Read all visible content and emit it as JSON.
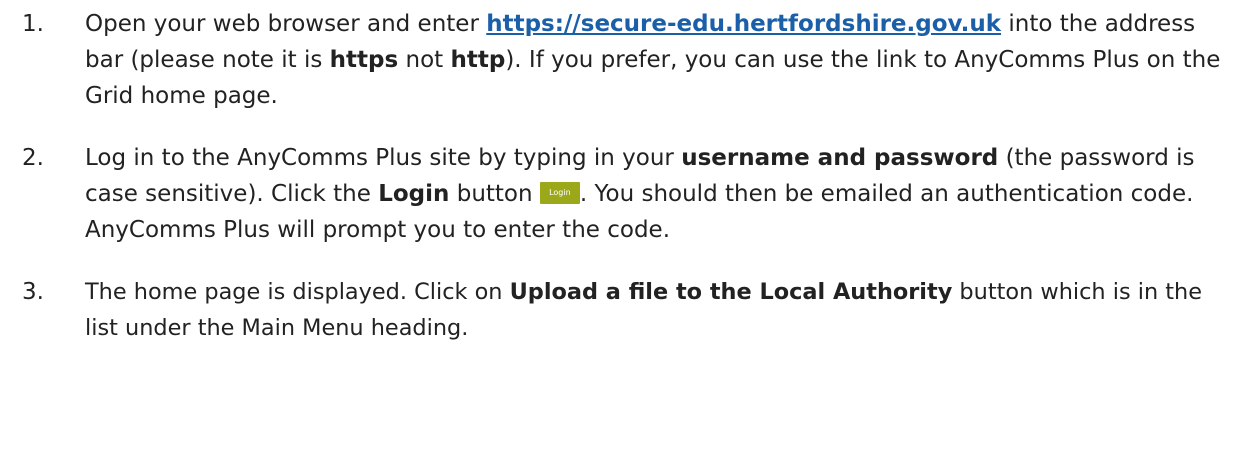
{
  "steps": [
    {
      "number": "1.",
      "text_1": "Open your web browser and enter ",
      "link": "https://secure-edu.hertfordshire.gov.uk",
      "text_2": " into the address bar (please note it is ",
      "bold_1": "https",
      "text_3": " not ",
      "bold_2": "http",
      "text_4": ").  If you prefer, you can use the link to AnyComms Plus on the Grid home page."
    },
    {
      "number": "2.",
      "text_1": "Log in to the AnyComms Plus site by typing in your ",
      "bold_1": "username and password",
      "text_2": " (the password is case sensitive).  Click the ",
      "bold_2": "Login",
      "text_3": " button ",
      "button_label": "Login",
      "text_4": ".  You should then be emailed an authentication code. AnyComms Plus will prompt you to enter the code."
    },
    {
      "number": "3.",
      "text_1": "The home page is displayed.  Click on ",
      "bold_1": "Upload a file to the Local Authority",
      "text_2": " button which is in the list under the Main Menu heading."
    }
  ],
  "colors": {
    "link": "#1a5fa8",
    "login_button": "#9aa81a"
  }
}
